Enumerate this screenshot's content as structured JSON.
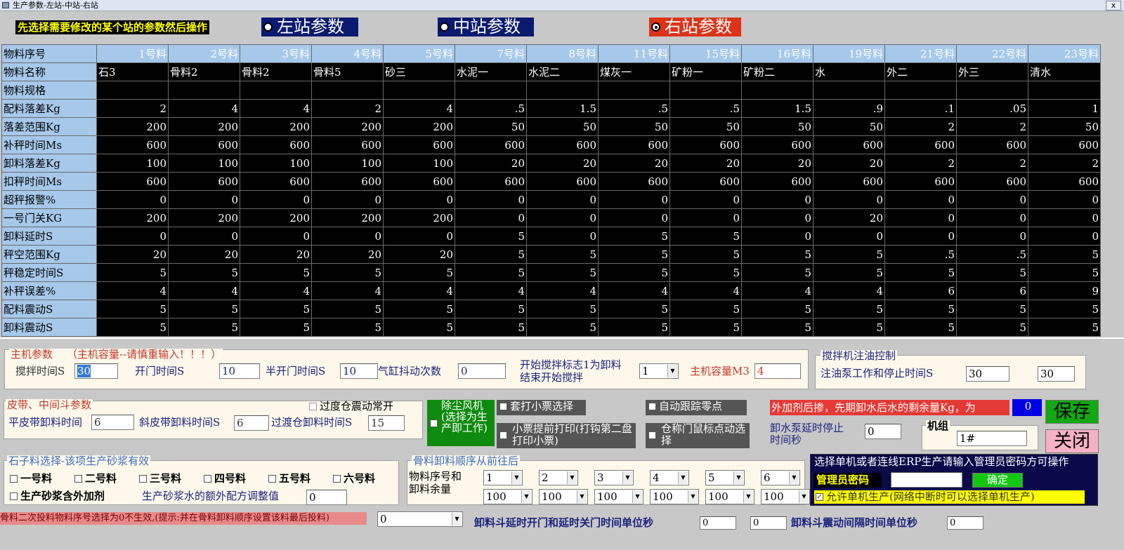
{
  "window": {
    "title": "生产参数-左站-中站-右站",
    "close_label": "x"
  },
  "hint": "先选择需要修改的某个站的参数然后操作",
  "stations": [
    {
      "label": "左站参数",
      "color": "#0a1a6e",
      "selected": false
    },
    {
      "label": "中站参数",
      "color": "#0a1a6e",
      "selected": false
    },
    {
      "label": "右站参数",
      "color": "#dd3319",
      "selected": true
    }
  ],
  "table": {
    "header_label": "物料序号",
    "columns": [
      "1号料",
      "2号料",
      "3号料",
      "4号料",
      "5号料",
      "7号料",
      "8号料",
      "11号料",
      "15号料",
      "16号料",
      "19号料",
      "21号料",
      "22号料",
      "23号料"
    ],
    "name_label": "物料名称",
    "names": [
      "石3",
      "骨料2",
      "骨料2",
      "骨料5",
      "砂三",
      "水泥一",
      "水泥二",
      "煤灰一",
      "矿粉一",
      "矿粉二",
      "水",
      "外二",
      "外三",
      "清水"
    ],
    "rows": [
      {
        "label": "物料规格",
        "values": [
          "",
          "",
          "",
          "",
          "",
          "",
          "",
          "",
          "",
          "",
          "",
          "",
          "",
          ""
        ]
      },
      {
        "label": "配料落差Kg",
        "values": [
          "2",
          "4",
          "4",
          "2",
          "4",
          ".5",
          "1.5",
          ".5",
          ".5",
          "1.5",
          ".9",
          ".1",
          ".05",
          "1"
        ]
      },
      {
        "label": "落差范围Kg",
        "values": [
          "200",
          "200",
          "200",
          "200",
          "200",
          "50",
          "50",
          "50",
          "50",
          "50",
          "50",
          "2",
          "2",
          "50"
        ]
      },
      {
        "label": "补秤时间Ms",
        "values": [
          "600",
          "600",
          "600",
          "600",
          "600",
          "600",
          "600",
          "600",
          "600",
          "600",
          "600",
          "600",
          "600",
          "600"
        ]
      },
      {
        "label": "卸料落差Kg",
        "values": [
          "100",
          "100",
          "100",
          "100",
          "100",
          "20",
          "20",
          "20",
          "20",
          "20",
          "20",
          "2",
          "2",
          "2"
        ]
      },
      {
        "label": "扣秤时间Ms",
        "values": [
          "600",
          "600",
          "600",
          "600",
          "600",
          "600",
          "600",
          "600",
          "600",
          "600",
          "600",
          "600",
          "600",
          "600"
        ]
      },
      {
        "label": "超秤报警%",
        "values": [
          "0",
          "0",
          "0",
          "0",
          "0",
          "0",
          "0",
          "0",
          "0",
          "0",
          "0",
          "0",
          "0",
          "0"
        ]
      },
      {
        "label": "一号门关KG",
        "values": [
          "200",
          "200",
          "200",
          "200",
          "200",
          "0",
          "0",
          "0",
          "0",
          "0",
          "20",
          "0",
          "0",
          "0"
        ]
      },
      {
        "label": "卸料延时S",
        "values": [
          "0",
          "0",
          "0",
          "0",
          "0",
          "5",
          "0",
          "5",
          "5",
          "0",
          "0",
          "0",
          "0",
          "0"
        ]
      },
      {
        "label": "秤空范围Kg",
        "values": [
          "20",
          "20",
          "20",
          "20",
          "20",
          "5",
          "5",
          "5",
          "5",
          "5",
          "5",
          ".5",
          ".5",
          "5"
        ]
      },
      {
        "label": "秤稳定时间S",
        "values": [
          "5",
          "5",
          "5",
          "5",
          "5",
          "5",
          "5",
          "5",
          "5",
          "5",
          "5",
          "5",
          "5",
          "5"
        ]
      },
      {
        "label": "补秤误差%",
        "values": [
          "4",
          "4",
          "4",
          "4",
          "4",
          "4",
          "4",
          "4",
          "4",
          "4",
          "4",
          "6",
          "6",
          "9"
        ]
      },
      {
        "label": "配料震动S",
        "values": [
          "5",
          "5",
          "5",
          "5",
          "5",
          "5",
          "5",
          "5",
          "5",
          "5",
          "5",
          "5",
          "5",
          "5"
        ]
      },
      {
        "label": "卸料震动S",
        "values": [
          "5",
          "5",
          "5",
          "5",
          "5",
          "5",
          "5",
          "5",
          "5",
          "5",
          "5",
          "5",
          "5",
          "5"
        ]
      }
    ]
  },
  "host": {
    "legend_title": "主机参数",
    "legend_warn": "（主机容量--请慎重输入！！！）",
    "mix_time_label": "搅拌时间S",
    "mix_time": "30",
    "open_time_label": "开门时间S",
    "open_time": "10",
    "half_open_label": "半开门时间S",
    "half_open": "10",
    "cylinder_label": "气缸抖动次数",
    "cylinder": "0",
    "start_flag_label1": "开始搅拌标志1为卸料",
    "start_flag_label2": "结束开始搅拌",
    "start_flag": "1",
    "capacity_label": "主机容量M3",
    "capacity": "4"
  },
  "oil": {
    "legend": "搅拌机注油控制",
    "label": "注油泵工作和停止时间S",
    "work": "30",
    "stop": "30"
  },
  "belt": {
    "legend": "皮带、中间斗参数",
    "transit_vibration_label": "过度仓震动常开",
    "flat_label": "平皮带卸料时间",
    "flat": "6",
    "incline_label": "斜皮带卸料时间S",
    "incline": "6",
    "transit_label": "过渡仓卸料时间S",
    "transit": "15"
  },
  "dust": {
    "label": "除尘风机(选择为生产即工作)",
    "color": "#0e8a0e"
  },
  "ticket_select": "套打小票选择",
  "ticket_early": "小票提前打印(打钩第二盘打印小票)",
  "auto_zero": "自动跟踪零点",
  "scale_door": "仓称门鼠标点动选择",
  "additive": {
    "label": "外加剂后掺，先期卸水后水的剩余量Kg，为",
    "value": "0"
  },
  "save_label": "保存",
  "close_label": "关闭",
  "pump": {
    "label1": "卸水泵延时停止",
    "label2": "时间秒",
    "value": "0"
  },
  "unit": {
    "label": "机组",
    "value": "1#"
  },
  "stone": {
    "legend": "石子料选择-该项生产砂浆有效",
    "options": [
      "一号料",
      "二号料",
      "三号料",
      "四号料",
      "五号料",
      "六号料"
    ],
    "mortar_additive": "生产砂浆含外加剂",
    "mortar_water_label": "生产砂浆水的额外配方调整值",
    "mortar_water": "0"
  },
  "order": {
    "legend": "骨料卸料顺序从前往后",
    "label1": "物料序号和",
    "label2": "卸料余量",
    "seq": [
      "1",
      "2",
      "3",
      "4",
      "5",
      "6"
    ],
    "remain": [
      "100",
      "100",
      "100",
      "100",
      "100",
      "100"
    ]
  },
  "erp": {
    "title": "选择单机或者连线ERP生产请输入管理员密码方可操作",
    "pwd_label": "管理员密码",
    "ok_label": "确定",
    "standalone_label": "允许单机生产(网络中断时可以选择单机生产)"
  },
  "bottom": {
    "note": "骨料二次投料物料序号选择为0不生效,(提示:并在骨料卸料顺序设置该料最后投料)",
    "note_select": "0",
    "delay_label": "卸料斗延时开门和延时关门时间单位秒",
    "delay_open": "0",
    "delay_close": "0",
    "vib_label": "卸料斗震动间隔时间单位秒",
    "vib": "0"
  }
}
